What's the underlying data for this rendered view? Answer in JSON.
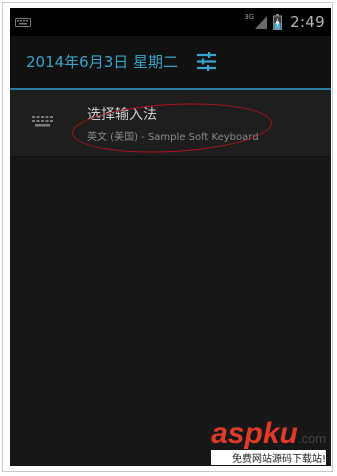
{
  "status_bar": {
    "network_type": "3G",
    "time": "2:49"
  },
  "header": {
    "date": "2014年6月3日 星期二"
  },
  "input_method": {
    "title": "选择输入法",
    "subtitle": "英文 (美国) - Sample Soft Keyboard"
  },
  "watermark": {
    "brand_left": "asp",
    "brand_right": "ku",
    "domain": ".com",
    "tagline": "免费网站源码下载站!"
  },
  "icons": {
    "status_keyboard": "keyboard-icon",
    "signal": "signal-icon",
    "battery": "battery-charging-icon",
    "settings": "sliders-icon",
    "ime": "keyboard-icon"
  },
  "colors": {
    "accent": "#3aa3c9",
    "annotation": "#b5141b",
    "watermark_red": "#e23a2a"
  }
}
